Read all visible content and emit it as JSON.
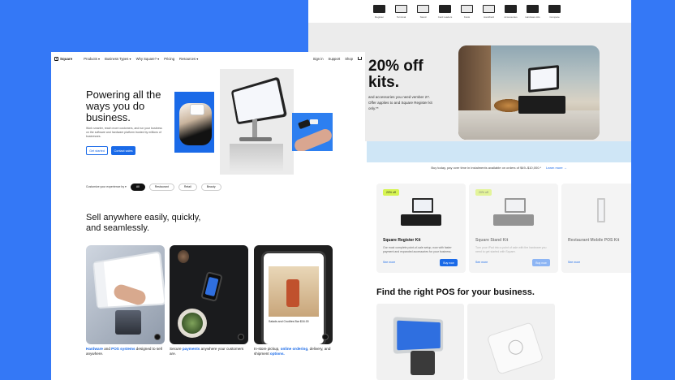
{
  "colors": {
    "background": "#3478f6",
    "accent": "#1a6ae8",
    "promo_badge": "#d6f451"
  },
  "back_page": {
    "category_nav": [
      {
        "label": "Register",
        "icon": "register-icon"
      },
      {
        "label": "Terminal",
        "icon": "terminal-icon"
      },
      {
        "label": "Stand",
        "icon": "stand-icon"
      },
      {
        "label": "Card readers",
        "icon": "reader-icon"
      },
      {
        "label": "Kiosk",
        "icon": "kiosk-icon"
      },
      {
        "label": "Handheld",
        "icon": "handheld-icon"
      },
      {
        "label": "Accessories",
        "icon": "accessories-icon"
      },
      {
        "label": "Hardware kits",
        "icon": "kits-icon"
      },
      {
        "label": "Compare",
        "icon": "compare-icon"
      }
    ],
    "promo": {
      "title_line1": "20% off",
      "title_line2": "kits.",
      "body": "and accessories you need vember 27. Offer applies to and Square Register kit only.**"
    },
    "finance": {
      "text": "Buy today, pay over time in instalments available on orders of $49–$10,000.*",
      "link": "Learn more →"
    },
    "kits": [
      {
        "badge": "20% off",
        "name": "Square Register Kit",
        "desc": "Our most complete point-of-sale setup, now with faster payment and expanded accessories for your business.",
        "more": "See more",
        "buy": "Buy now"
      },
      {
        "badge": "20% off",
        "name": "Square Stand Kit",
        "desc": "Turn your iPad into a point of sale with the hardware you need to get started with Square.",
        "more": "See more",
        "buy": "Buy now"
      },
      {
        "badge": "",
        "name": "Restaurant Mobile POS Kit",
        "desc": "",
        "more": "See more",
        "buy": ""
      }
    ],
    "find_title": "Find the right POS for your business."
  },
  "front_page": {
    "nav": {
      "logo": "Square",
      "links": [
        "Products ▾",
        "Business Types ▾",
        "Why Square? ▾",
        "Pricing",
        "Resources ▾"
      ],
      "right": [
        "Sign in",
        "Support",
        "Shop"
      ]
    },
    "hero": {
      "title": "Powering all the ways you do business.",
      "subtitle": "Work smarter, reach more customers, and run your business on the software and hardware platform trusted by millions of businesses.",
      "btn_primary": "Get started",
      "btn_secondary": "Contact sales"
    },
    "customize": {
      "label": "Customize your experience by ▾",
      "pills": [
        "All",
        "Restaurant",
        "Retail",
        "Beauty"
      ],
      "active_index": 0
    },
    "sell": {
      "title": "Sell anywhere easily, quickly, and seamlessly."
    },
    "tiles": [
      {
        "hl1": "Hardware",
        "t1": " and ",
        "hl2": "POS systems",
        "t2": " designed to sell anywhere.",
        "t3": ""
      },
      {
        "hl1": "",
        "t1": "Secure ",
        "hl2": "payments",
        "t2": " anywhere your customers are.",
        "t3": ""
      },
      {
        "hl1": "",
        "t1": "In-store pickup, ",
        "hl2": "online ordering",
        "t2": ", delivery, and shipment ",
        "t3": "options."
      }
    ],
    "tablet_menu": "Salads and Crudites Bar $16.00"
  }
}
